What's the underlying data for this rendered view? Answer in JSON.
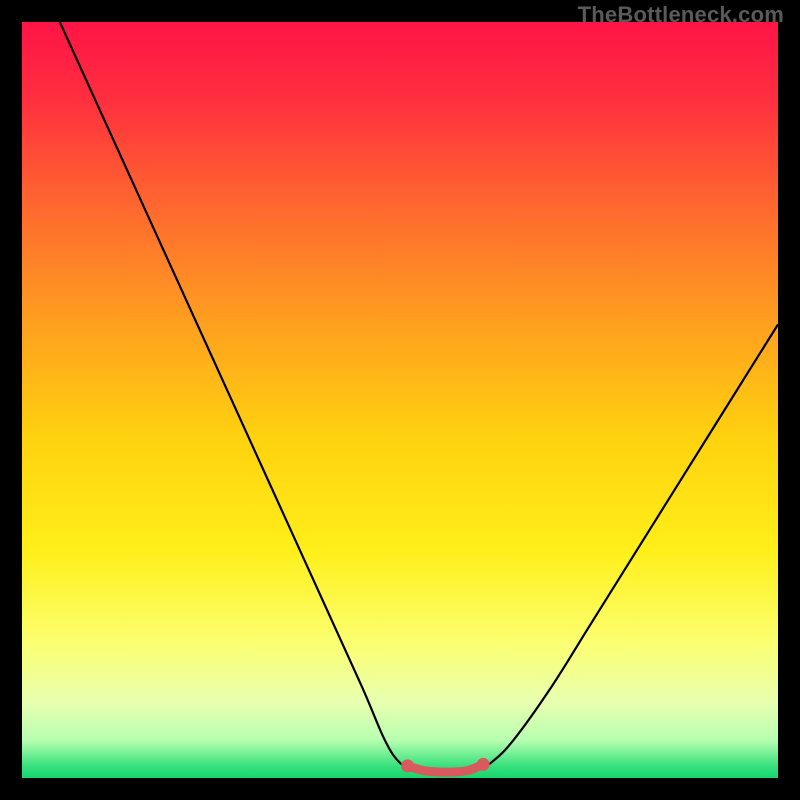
{
  "attribution": "TheBottleneck.com",
  "colors": {
    "gradient_stops": [
      {
        "offset": 0.0,
        "color": "#ff1446"
      },
      {
        "offset": 0.1,
        "color": "#ff2e3f"
      },
      {
        "offset": 0.25,
        "color": "#ff6a2e"
      },
      {
        "offset": 0.4,
        "color": "#ffa01f"
      },
      {
        "offset": 0.55,
        "color": "#ffd20f"
      },
      {
        "offset": 0.7,
        "color": "#ffef1a"
      },
      {
        "offset": 0.82,
        "color": "#fbff70"
      },
      {
        "offset": 0.9,
        "color": "#e8ffb0"
      },
      {
        "offset": 0.95,
        "color": "#b7ffb0"
      },
      {
        "offset": 0.985,
        "color": "#35e07c"
      },
      {
        "offset": 1.0,
        "color": "#17d56d"
      }
    ],
    "curve": "#000000",
    "marker": "#d85a5f",
    "background": "#000000"
  },
  "chart_data": {
    "type": "line",
    "title": "",
    "xlabel": "",
    "ylabel": "",
    "xlim": [
      0,
      100
    ],
    "ylim": [
      0,
      100
    ],
    "series": [
      {
        "name": "bottleneck-curve",
        "x": [
          5,
          10,
          15,
          20,
          25,
          30,
          35,
          40,
          45,
          48,
          50,
          52,
          55,
          58,
          60,
          62,
          65,
          70,
          75,
          80,
          85,
          90,
          95,
          100
        ],
        "y": [
          100,
          89,
          78,
          67,
          56,
          45,
          34,
          23,
          12,
          5,
          2,
          1,
          1,
          1,
          1,
          2,
          5,
          12,
          20,
          28,
          36,
          44,
          52,
          60
        ]
      }
    ],
    "markers": {
      "name": "optimal-range",
      "x": [
        51,
        53,
        55,
        57,
        59,
        61
      ],
      "y": [
        1.6,
        1.0,
        0.8,
        0.8,
        1.0,
        1.8
      ]
    }
  }
}
